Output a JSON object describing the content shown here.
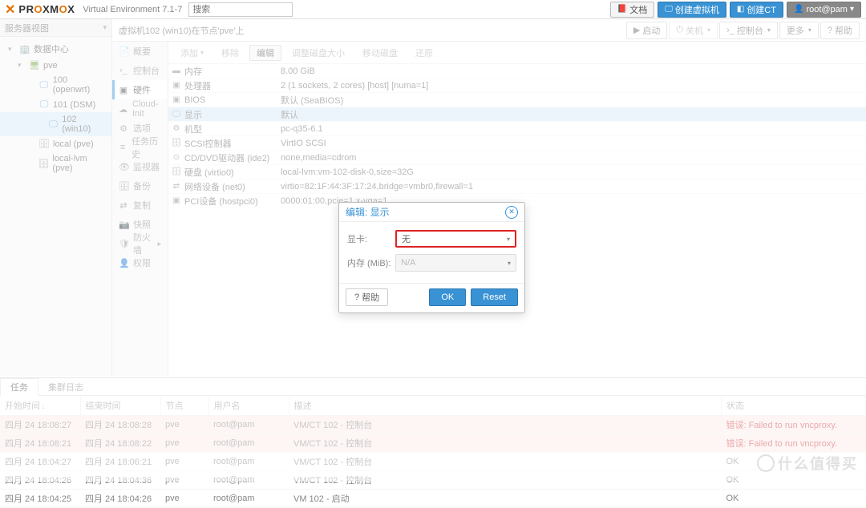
{
  "header": {
    "brand_prefix": "PR",
    "brand_o": "O",
    "brand_suffix": "XM",
    "brand_o2": "O",
    "brand_end": "X",
    "version": "Virtual Environment 7.1-7",
    "search_placeholder": "搜索"
  },
  "top_buttons": {
    "docs": "文档",
    "create_vm": "创建虚拟机",
    "create_ct": "创建CT",
    "user": "root@pam"
  },
  "sidebar": {
    "view_label": "服务器视图",
    "items": [
      {
        "label": "数据中心",
        "icon": "🏢"
      },
      {
        "label": "pve",
        "icon": "🖥"
      },
      {
        "label": "100 (openwrt)",
        "icon": "💻"
      },
      {
        "label": "101 (DSM)",
        "icon": "💻"
      },
      {
        "label": "102 (win10)",
        "icon": "💻"
      },
      {
        "label": "local (pve)",
        "icon": "🗄"
      },
      {
        "label": "local-lvm (pve)",
        "icon": "🗄"
      }
    ]
  },
  "breadcrumb": "虚拟机102 (win10)在节点'pve'上",
  "content_buttons": {
    "start": "启动",
    "shutdown": "关机",
    "console": "控制台",
    "more": "更多",
    "help": "帮助"
  },
  "tabs": [
    {
      "label": "概要",
      "icon": "📄"
    },
    {
      "label": "控制台",
      "icon": "›_"
    },
    {
      "label": "硬件",
      "icon": "⚙"
    },
    {
      "label": "Cloud-Init",
      "icon": "☁"
    },
    {
      "label": "选项",
      "icon": "⚙"
    },
    {
      "label": "任务历史",
      "icon": "≡"
    },
    {
      "label": "监视器",
      "icon": "👁"
    },
    {
      "label": "备份",
      "icon": "🗄"
    },
    {
      "label": "复制",
      "icon": "⇄"
    },
    {
      "label": "快照",
      "icon": "📷"
    },
    {
      "label": "防火墙",
      "icon": "🛡"
    },
    {
      "label": "权限",
      "icon": "👤"
    }
  ],
  "toolbar": {
    "add": "添加",
    "remove": "移除",
    "edit": "编辑",
    "resize": "调整磁盘大小",
    "move": "移动磁盘",
    "revert": "还原"
  },
  "hw": [
    {
      "icon": "▬",
      "key": "内存",
      "val": "8.00 GiB"
    },
    {
      "icon": "▣",
      "key": "处理器",
      "val": "2 (1 sockets, 2 cores) [host] [numa=1]"
    },
    {
      "icon": "▣",
      "key": "BIOS",
      "val": "默认 (SeaBIOS)"
    },
    {
      "icon": "🖵",
      "key": "显示",
      "val": "默认"
    },
    {
      "icon": "⚙",
      "key": "机型",
      "val": "pc-q35-6.1"
    },
    {
      "icon": "🗄",
      "key": "SCSI控制器",
      "val": "VirtIO SCSI"
    },
    {
      "icon": "⊙",
      "key": "CD/DVD驱动器 (ide2)",
      "val": "none,media=cdrom"
    },
    {
      "icon": "🗄",
      "key": "硬盘 (virtio0)",
      "val": "local-lvm:vm-102-disk-0,size=32G"
    },
    {
      "icon": "⇄",
      "key": "网络设备 (net0)",
      "val": "virtio=82:1F:44:3F:17:24,bridge=vmbr0,firewall=1"
    },
    {
      "icon": "▣",
      "key": "PCI设备 (hostpci0)",
      "val": "0000:01:00,pcie=1,x-vga=1"
    }
  ],
  "dialog": {
    "title": "编辑: 显示",
    "gpu_label": "显卡:",
    "gpu_value": "无",
    "mem_label": "内存 (MiB):",
    "mem_value": "N/A",
    "help": "帮助",
    "ok": "OK",
    "reset": "Reset"
  },
  "tasks": {
    "tab1": "任务",
    "tab2": "集群日志",
    "cols": {
      "start": "开始时间",
      "end": "结束时间",
      "node": "节点",
      "user": "用户名",
      "desc": "描述",
      "status": "状态"
    },
    "rows": [
      {
        "start": "四月 24 18:08:27",
        "end": "四月 24 18:08:28",
        "node": "pve",
        "user": "root@pam",
        "desc": "VM/CT 102 - 控制台",
        "status": "错误: Failed to run vncproxy.",
        "err": true
      },
      {
        "start": "四月 24 18:08:21",
        "end": "四月 24 18:08:22",
        "node": "pve",
        "user": "root@pam",
        "desc": "VM/CT 102 - 控制台",
        "status": "错误: Failed to run vncproxy.",
        "err": true
      },
      {
        "start": "四月 24 18:04:27",
        "end": "四月 24 18:06:21",
        "node": "pve",
        "user": "root@pam",
        "desc": "VM/CT 102 - 控制台",
        "status": "OK",
        "err": false
      },
      {
        "start": "四月 24 18:04:26",
        "end": "四月 24 18:04:36",
        "node": "pve",
        "user": "root@pam",
        "desc": "VM/CT 102 - 控制台",
        "status": "OK",
        "err": false
      },
      {
        "start": "四月 24 18:04:25",
        "end": "四月 24 18:04:26",
        "node": "pve",
        "user": "root@pam",
        "desc": "VM 102 - 启动",
        "status": "OK",
        "err": false
      }
    ]
  },
  "watermark": "什么值得买"
}
